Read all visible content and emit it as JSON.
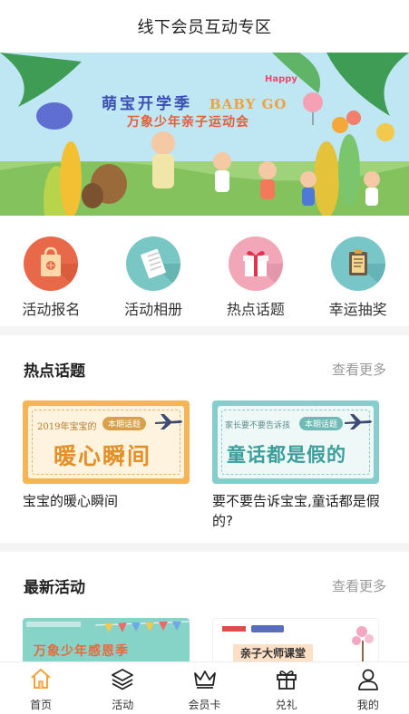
{
  "header": {
    "title": "线下会员互动专区"
  },
  "banner": {
    "title_main": "萌宝开学季",
    "title_en": "BABY GO",
    "subtitle": "万象少年亲子运动会",
    "badge": "Happy"
  },
  "quick_actions": [
    {
      "label": "活动报名",
      "icon": "shopping-bag-icon",
      "color": "#e8694a"
    },
    {
      "label": "活动相册",
      "icon": "newspaper-icon",
      "color": "#78c7c4"
    },
    {
      "label": "热点话题",
      "icon": "gift-icon",
      "color": "#f1a7b8"
    },
    {
      "label": "幸运抽奖",
      "icon": "clipboard-icon",
      "color": "#79c6c9"
    }
  ],
  "hot_topics": {
    "title": "热点话题",
    "more": "查看更多",
    "items": [
      {
        "image_text": "暖心瞬间",
        "image_header": "2019年宝宝的",
        "tag": "本期话题",
        "caption": "宝宝的暖心瞬间",
        "color": "#f5b556"
      },
      {
        "image_text": "童话都是假的",
        "image_header": "家长要不要告诉孩",
        "tag": "本期话题",
        "caption": "要不要告诉宝宝,童话都是假的?",
        "color": "#86cdcd"
      }
    ]
  },
  "latest": {
    "title": "最新活动",
    "more": "查看更多",
    "items": [
      {
        "text": "万象少年感恩季"
      },
      {
        "text": "亲子大师课堂"
      }
    ]
  },
  "tabbar": [
    {
      "label": "首页",
      "icon": "home-icon",
      "active": true
    },
    {
      "label": "活动",
      "icon": "layers-icon",
      "active": false
    },
    {
      "label": "会员卡",
      "icon": "crown-icon",
      "active": false
    },
    {
      "label": "兑礼",
      "icon": "gift-icon",
      "active": false
    },
    {
      "label": "我的",
      "icon": "user-icon",
      "active": false
    }
  ],
  "colors": {
    "accent": "#f5a23a",
    "muted": "#999999"
  }
}
